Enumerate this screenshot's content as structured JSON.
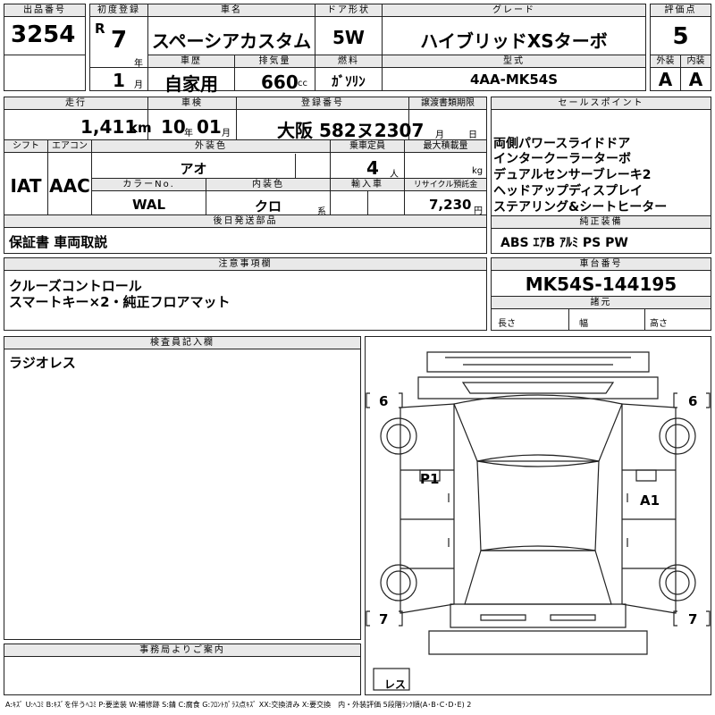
{
  "header": {
    "lot_label": "出品番号",
    "lot_number": "3254",
    "first_reg_label": "初度登録",
    "era": "R",
    "year_value": "7",
    "year_unit": "年",
    "month_value": "1",
    "month_unit": "月",
    "car_name_label": "車名",
    "car_name": "スペーシアカスタム",
    "door_label": "ドア形状",
    "door": "5W",
    "grade_label": "グレード",
    "grade": "ハイブリッドXSターボ",
    "score_label": "評価点",
    "score": "5",
    "history_label": "車歴",
    "history": "自家用",
    "displacement_label": "排気量",
    "displacement": "660",
    "displacement_unit": "cc",
    "fuel_label": "燃料",
    "fuel": "ｶﾞｿﾘﾝ",
    "model_label": "型式",
    "model": "4AA-MK54S",
    "exterior_label": "外装",
    "exterior": "A",
    "interior_label": "内装",
    "interior": "A"
  },
  "specs": {
    "mileage_label": "走行",
    "mileage": "1,411",
    "mileage_unit": "km",
    "inspection_label": "車検",
    "inspection_year": "10",
    "inspection_year_unit": "年",
    "inspection_month": "01",
    "inspection_month_unit": "月",
    "registration_label": "登録番号",
    "registration": "大阪 582ヌ2307",
    "transfer_label": "譲渡書類期限",
    "transfer_month_unit": "月",
    "transfer_day_unit": "日",
    "shift_label": "シフト",
    "shift": "IAT",
    "ac_label": "エアコン",
    "ac": "AAC",
    "ext_color_label": "外装色",
    "ext_color": "アオ",
    "capacity_label": "乗車定員",
    "capacity": "4",
    "capacity_unit": "人",
    "max_load_label": "最大積載量",
    "max_load_unit": "kg",
    "color_no_label": "カラーNo.",
    "color_no": "WAL",
    "int_color_label": "内装色",
    "int_color": "クロ",
    "int_color_unit": "系",
    "import_label": "輸入車",
    "recycle_label": "リサイクル預託金",
    "recycle": "7,230",
    "recycle_unit": "円"
  },
  "sales_points": {
    "label": "セールスポイント",
    "items": [
      "両側パワースライドドア",
      "インタークーラーターボ",
      "デュアルセンサーブレーキ2",
      "ヘッドアップディスプレイ",
      "ステアリング&シートヒーター"
    ]
  },
  "later_parts": {
    "label": "後日発送部品",
    "value": "保証書 車両取説"
  },
  "genuine_equipment": {
    "label": "純正装備",
    "value": "ABS ｴｱB ｱﾙﾐ PS PW"
  },
  "notes": {
    "label": "注意事項欄",
    "lines": [
      "クルーズコントロール",
      "スマートキー×2・純正フロアマット"
    ]
  },
  "chassis": {
    "label": "車台番号",
    "value": "MK54S-144195"
  },
  "dimensions": {
    "label": "諸元",
    "length": "長さ",
    "width": "幅",
    "height": "高さ"
  },
  "inspector": {
    "label": "検査員記入欄",
    "value": "ラジオレス"
  },
  "office": {
    "label": "事務局よりご案内"
  },
  "diagram": {
    "tire_fl": "6",
    "tire_fr": "6",
    "tire_rl": "7",
    "tire_rr": "7",
    "mark_left": "P1",
    "mark_right": "A1",
    "spare": "レス"
  },
  "legend": "A:ｷｽﾞ U:ﾍｺﾐ B:ｷｽﾞを伴うﾍｺﾐ P:要塗装 W:補修跡 S:錆 C:腐食 G:ﾌﾛﾝﾄｶﾞﾗｽ点ｷｽﾞ XX:交換済み X:要交換　内・外装評価 5段階ﾗﾝｸ順(A･B･C･D･E) 2"
}
